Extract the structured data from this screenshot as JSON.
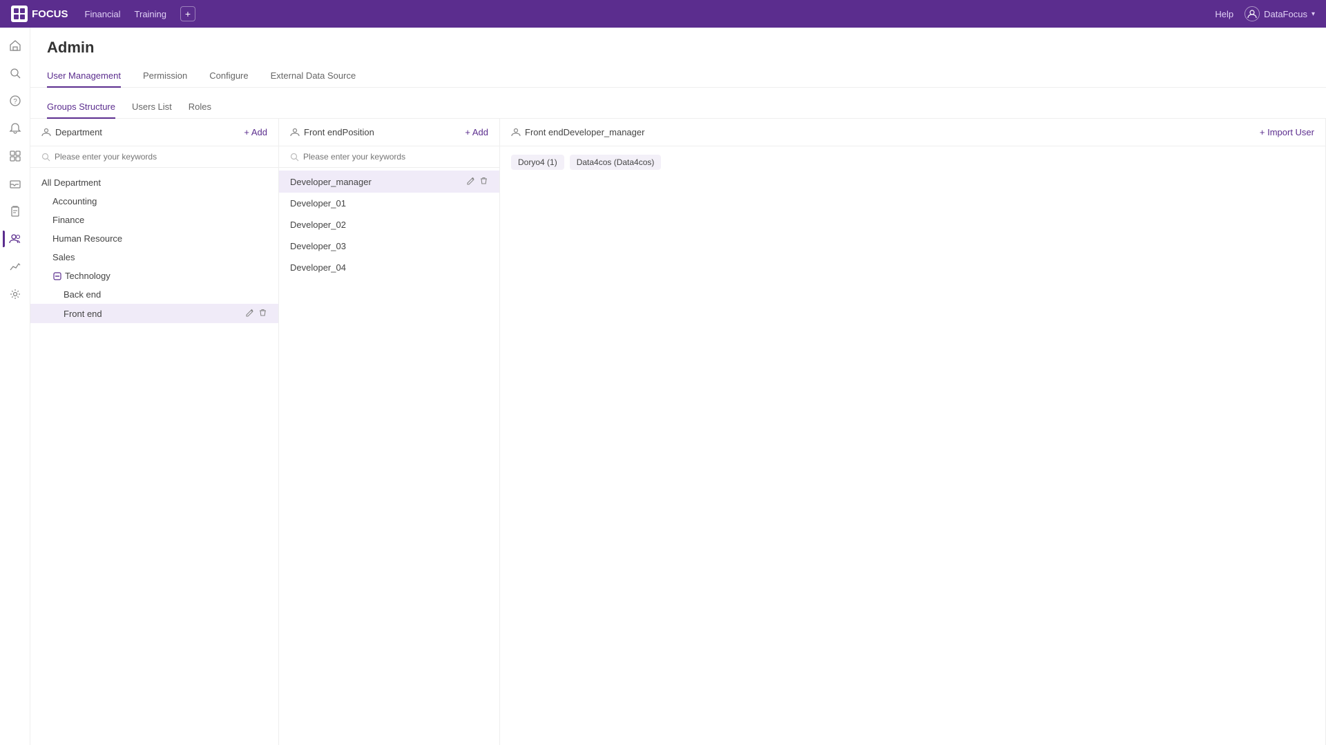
{
  "app": {
    "logo_text": "FOCUS",
    "nav_items": [
      "Financial",
      "Training"
    ],
    "add_label": "+",
    "help_label": "Help",
    "user_label": "DataFocus",
    "user_icon": "👤"
  },
  "sidebar": {
    "items": [
      {
        "name": "home-icon",
        "icon": "⌂"
      },
      {
        "name": "search-icon",
        "icon": "🔍"
      },
      {
        "name": "help-icon",
        "icon": "?"
      },
      {
        "name": "notification-icon",
        "icon": "🔔"
      },
      {
        "name": "grid-icon",
        "icon": "⊞"
      },
      {
        "name": "inbox-icon",
        "icon": "▭"
      },
      {
        "name": "clipboard-icon",
        "icon": "📋"
      },
      {
        "name": "user-icon",
        "icon": "👤"
      },
      {
        "name": "analytics-icon",
        "icon": "📈"
      },
      {
        "name": "settings-icon",
        "icon": "⚙"
      }
    ]
  },
  "page": {
    "title": "Admin",
    "tabs": [
      {
        "label": "User Management",
        "active": true
      },
      {
        "label": "Permission",
        "active": false
      },
      {
        "label": "Configure",
        "active": false
      },
      {
        "label": "External Data Source",
        "active": false
      }
    ],
    "sub_tabs": [
      {
        "label": "Groups Structure",
        "active": true
      },
      {
        "label": "Users List",
        "active": false
      },
      {
        "label": "Roles",
        "active": false
      }
    ]
  },
  "department_col": {
    "header": "Department",
    "add_label": "+ Add",
    "search_placeholder": "Please enter your keywords",
    "items": [
      {
        "label": "All Department",
        "level": 0,
        "expandable": false
      },
      {
        "label": "Accounting",
        "level": 1,
        "expandable": false
      },
      {
        "label": "Finance",
        "level": 1,
        "expandable": false
      },
      {
        "label": "Human Resource",
        "level": 1,
        "expandable": false
      },
      {
        "label": "Sales",
        "level": 1,
        "expandable": false
      },
      {
        "label": "Technology",
        "level": 1,
        "expandable": true,
        "expanded": true,
        "collapse_icon": "−"
      },
      {
        "label": "Back end",
        "level": 2,
        "expandable": false
      },
      {
        "label": "Front end",
        "level": 2,
        "expandable": false,
        "selected": true,
        "has_actions": true
      }
    ]
  },
  "position_col": {
    "header": "Front endPosition",
    "add_label": "+ Add",
    "search_placeholder": "Please enter your keywords",
    "items": [
      {
        "label": "Developer_manager",
        "selected": true,
        "has_actions": true
      },
      {
        "label": "Developer_01"
      },
      {
        "label": "Developer_02"
      },
      {
        "label": "Developer_03"
      },
      {
        "label": "Developer_04"
      }
    ]
  },
  "developer_col": {
    "header": "Front endDeveloper_manager",
    "import_label": "+ Import User",
    "users": [
      {
        "label": "Doryo4 (1)"
      },
      {
        "label": "Data4cos (Data4cos)"
      }
    ]
  },
  "icons": {
    "person": "👤",
    "search": "🔍",
    "edit": "✏",
    "delete": "🗑",
    "plus": "+",
    "minus": "−"
  }
}
